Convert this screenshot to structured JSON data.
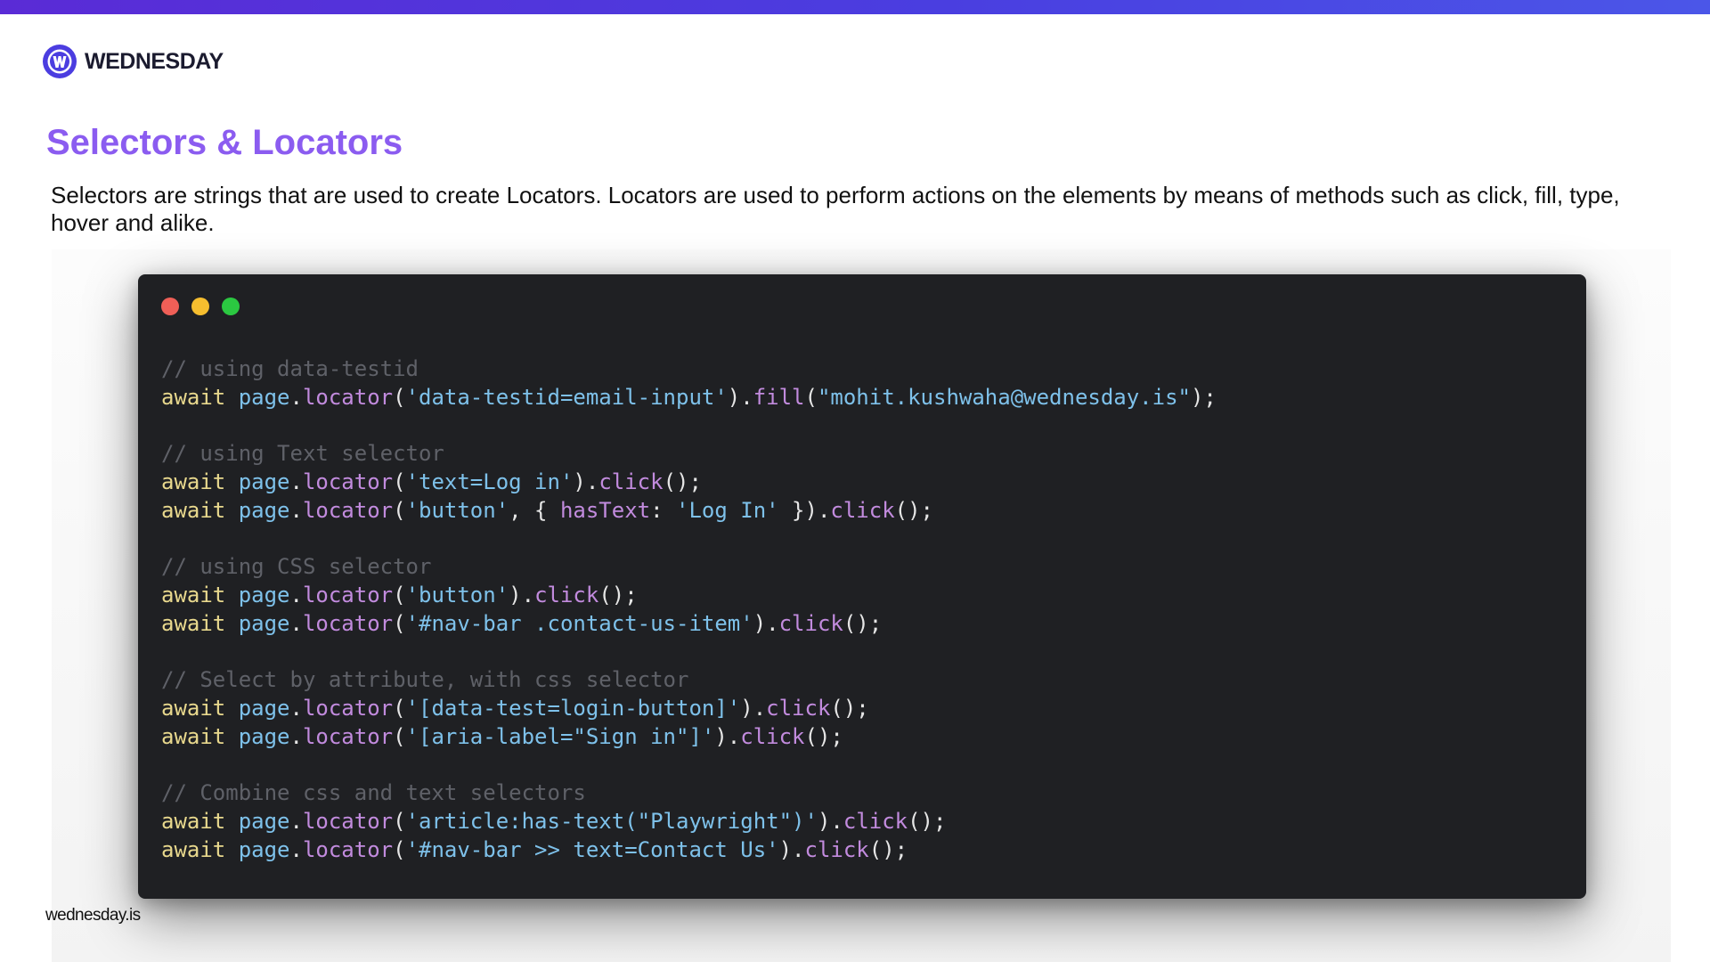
{
  "header": {
    "brand_name": "WEDNESDAY",
    "accent_bar_color": "#4a3ee0",
    "logo_icon": "wednesday-logo-icon"
  },
  "slide": {
    "title": "Selectors & Locators",
    "title_color": "#8b5cf0",
    "description": "Selectors are strings that are used to create Locators. Locators are used to perform actions on the elements by means of methods such as click, fill, type, hover and alike."
  },
  "code_window": {
    "background_color": "#1f2023",
    "traffic_lights": [
      "#ef5f57",
      "#f6be2f",
      "#2bc841"
    ],
    "blocks": [
      {
        "comment": "// using data-testid",
        "lines": [
          [
            {
              "t": "kw",
              "v": "await"
            },
            {
              "t": "punc",
              "v": " "
            },
            {
              "t": "obj",
              "v": "page"
            },
            {
              "t": "punc",
              "v": "."
            },
            {
              "t": "method",
              "v": "locator"
            },
            {
              "t": "punc",
              "v": "("
            },
            {
              "t": "str",
              "v": "'data-testid=email-input'"
            },
            {
              "t": "punc",
              "v": ")."
            },
            {
              "t": "method",
              "v": "fill"
            },
            {
              "t": "punc",
              "v": "("
            },
            {
              "t": "str",
              "v": "\"mohit.kushwaha@wednesday.is\""
            },
            {
              "t": "punc",
              "v": ");"
            }
          ]
        ]
      },
      {
        "comment": "// using Text selector",
        "lines": [
          [
            {
              "t": "kw",
              "v": "await"
            },
            {
              "t": "punc",
              "v": " "
            },
            {
              "t": "obj",
              "v": "page"
            },
            {
              "t": "punc",
              "v": "."
            },
            {
              "t": "method",
              "v": "locator"
            },
            {
              "t": "punc",
              "v": "("
            },
            {
              "t": "str",
              "v": "'text=Log in'"
            },
            {
              "t": "punc",
              "v": ")."
            },
            {
              "t": "method",
              "v": "click"
            },
            {
              "t": "punc",
              "v": "();"
            }
          ],
          [
            {
              "t": "kw",
              "v": "await"
            },
            {
              "t": "punc",
              "v": " "
            },
            {
              "t": "obj",
              "v": "page"
            },
            {
              "t": "punc",
              "v": "."
            },
            {
              "t": "method",
              "v": "locator"
            },
            {
              "t": "punc",
              "v": "("
            },
            {
              "t": "str",
              "v": "'button'"
            },
            {
              "t": "punc",
              "v": ", { "
            },
            {
              "t": "prop",
              "v": "hasText"
            },
            {
              "t": "punc",
              "v": ": "
            },
            {
              "t": "str",
              "v": "'Log In'"
            },
            {
              "t": "punc",
              "v": " })."
            },
            {
              "t": "method",
              "v": "click"
            },
            {
              "t": "punc",
              "v": "();"
            }
          ]
        ]
      },
      {
        "comment": "// using CSS selector",
        "lines": [
          [
            {
              "t": "kw",
              "v": "await"
            },
            {
              "t": "punc",
              "v": " "
            },
            {
              "t": "obj",
              "v": "page"
            },
            {
              "t": "punc",
              "v": "."
            },
            {
              "t": "method",
              "v": "locator"
            },
            {
              "t": "punc",
              "v": "("
            },
            {
              "t": "str",
              "v": "'button'"
            },
            {
              "t": "punc",
              "v": ")."
            },
            {
              "t": "method",
              "v": "click"
            },
            {
              "t": "punc",
              "v": "();"
            }
          ],
          [
            {
              "t": "kw",
              "v": "await"
            },
            {
              "t": "punc",
              "v": " "
            },
            {
              "t": "obj",
              "v": "page"
            },
            {
              "t": "punc",
              "v": "."
            },
            {
              "t": "method",
              "v": "locator"
            },
            {
              "t": "punc",
              "v": "("
            },
            {
              "t": "str",
              "v": "'#nav-bar .contact-us-item'"
            },
            {
              "t": "punc",
              "v": ")."
            },
            {
              "t": "method",
              "v": "click"
            },
            {
              "t": "punc",
              "v": "();"
            }
          ]
        ]
      },
      {
        "comment": "// Select by attribute, with css selector",
        "lines": [
          [
            {
              "t": "kw",
              "v": "await"
            },
            {
              "t": "punc",
              "v": " "
            },
            {
              "t": "obj",
              "v": "page"
            },
            {
              "t": "punc",
              "v": "."
            },
            {
              "t": "method",
              "v": "locator"
            },
            {
              "t": "punc",
              "v": "("
            },
            {
              "t": "str",
              "v": "'[data-test=login-button]'"
            },
            {
              "t": "punc",
              "v": ")."
            },
            {
              "t": "method",
              "v": "click"
            },
            {
              "t": "punc",
              "v": "();"
            }
          ],
          [
            {
              "t": "kw",
              "v": "await"
            },
            {
              "t": "punc",
              "v": " "
            },
            {
              "t": "obj",
              "v": "page"
            },
            {
              "t": "punc",
              "v": "."
            },
            {
              "t": "method",
              "v": "locator"
            },
            {
              "t": "punc",
              "v": "("
            },
            {
              "t": "str",
              "v": "'[aria-label=\"Sign in\"]'"
            },
            {
              "t": "punc",
              "v": ")."
            },
            {
              "t": "method",
              "v": "click"
            },
            {
              "t": "punc",
              "v": "();"
            }
          ]
        ]
      },
      {
        "comment": "// Combine css and text selectors",
        "lines": [
          [
            {
              "t": "kw",
              "v": "await"
            },
            {
              "t": "punc",
              "v": " "
            },
            {
              "t": "obj",
              "v": "page"
            },
            {
              "t": "punc",
              "v": "."
            },
            {
              "t": "method",
              "v": "locator"
            },
            {
              "t": "punc",
              "v": "("
            },
            {
              "t": "str",
              "v": "'article:has-text(\"Playwright\")'"
            },
            {
              "t": "punc",
              "v": ")."
            },
            {
              "t": "method",
              "v": "click"
            },
            {
              "t": "punc",
              "v": "();"
            }
          ],
          [
            {
              "t": "kw",
              "v": "await"
            },
            {
              "t": "punc",
              "v": " "
            },
            {
              "t": "obj",
              "v": "page"
            },
            {
              "t": "punc",
              "v": "."
            },
            {
              "t": "method",
              "v": "locator"
            },
            {
              "t": "punc",
              "v": "("
            },
            {
              "t": "str",
              "v": "'#nav-bar >> text=Contact Us'"
            },
            {
              "t": "punc",
              "v": ")."
            },
            {
              "t": "method",
              "v": "click"
            },
            {
              "t": "punc",
              "v": "();"
            }
          ]
        ]
      }
    ]
  },
  "footer": {
    "url_text": "wednesday.is"
  }
}
